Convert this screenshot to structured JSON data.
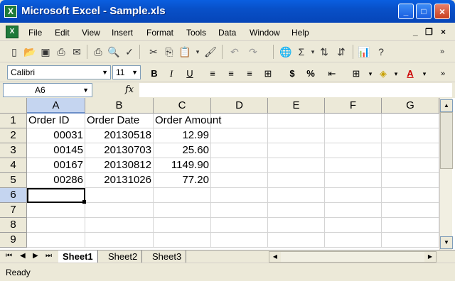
{
  "window": {
    "title": "Microsoft Excel - Sample.xls"
  },
  "menu": [
    "File",
    "Edit",
    "View",
    "Insert",
    "Format",
    "Tools",
    "Data",
    "Window",
    "Help"
  ],
  "formatting": {
    "font": "Calibri",
    "size": "11"
  },
  "formula_bar": {
    "name_box": "A6",
    "fx": "fx",
    "formula": ""
  },
  "columns": [
    "A",
    "B",
    "C",
    "D",
    "E",
    "F",
    "G"
  ],
  "rows": [
    "1",
    "2",
    "3",
    "4",
    "5",
    "6",
    "7",
    "8",
    "9"
  ],
  "cells": [
    [
      "Order ID",
      "Order Date",
      "Order Amount"
    ],
    [
      "00031",
      "20130518",
      "12.99"
    ],
    [
      "00145",
      "20130703",
      "25.60"
    ],
    [
      "00167",
      "20130812",
      "1149.90"
    ],
    [
      "00286",
      "20131026",
      "77.20"
    ]
  ],
  "sheets": [
    "Sheet1",
    "Sheet2",
    "Sheet3"
  ],
  "status": "Ready"
}
